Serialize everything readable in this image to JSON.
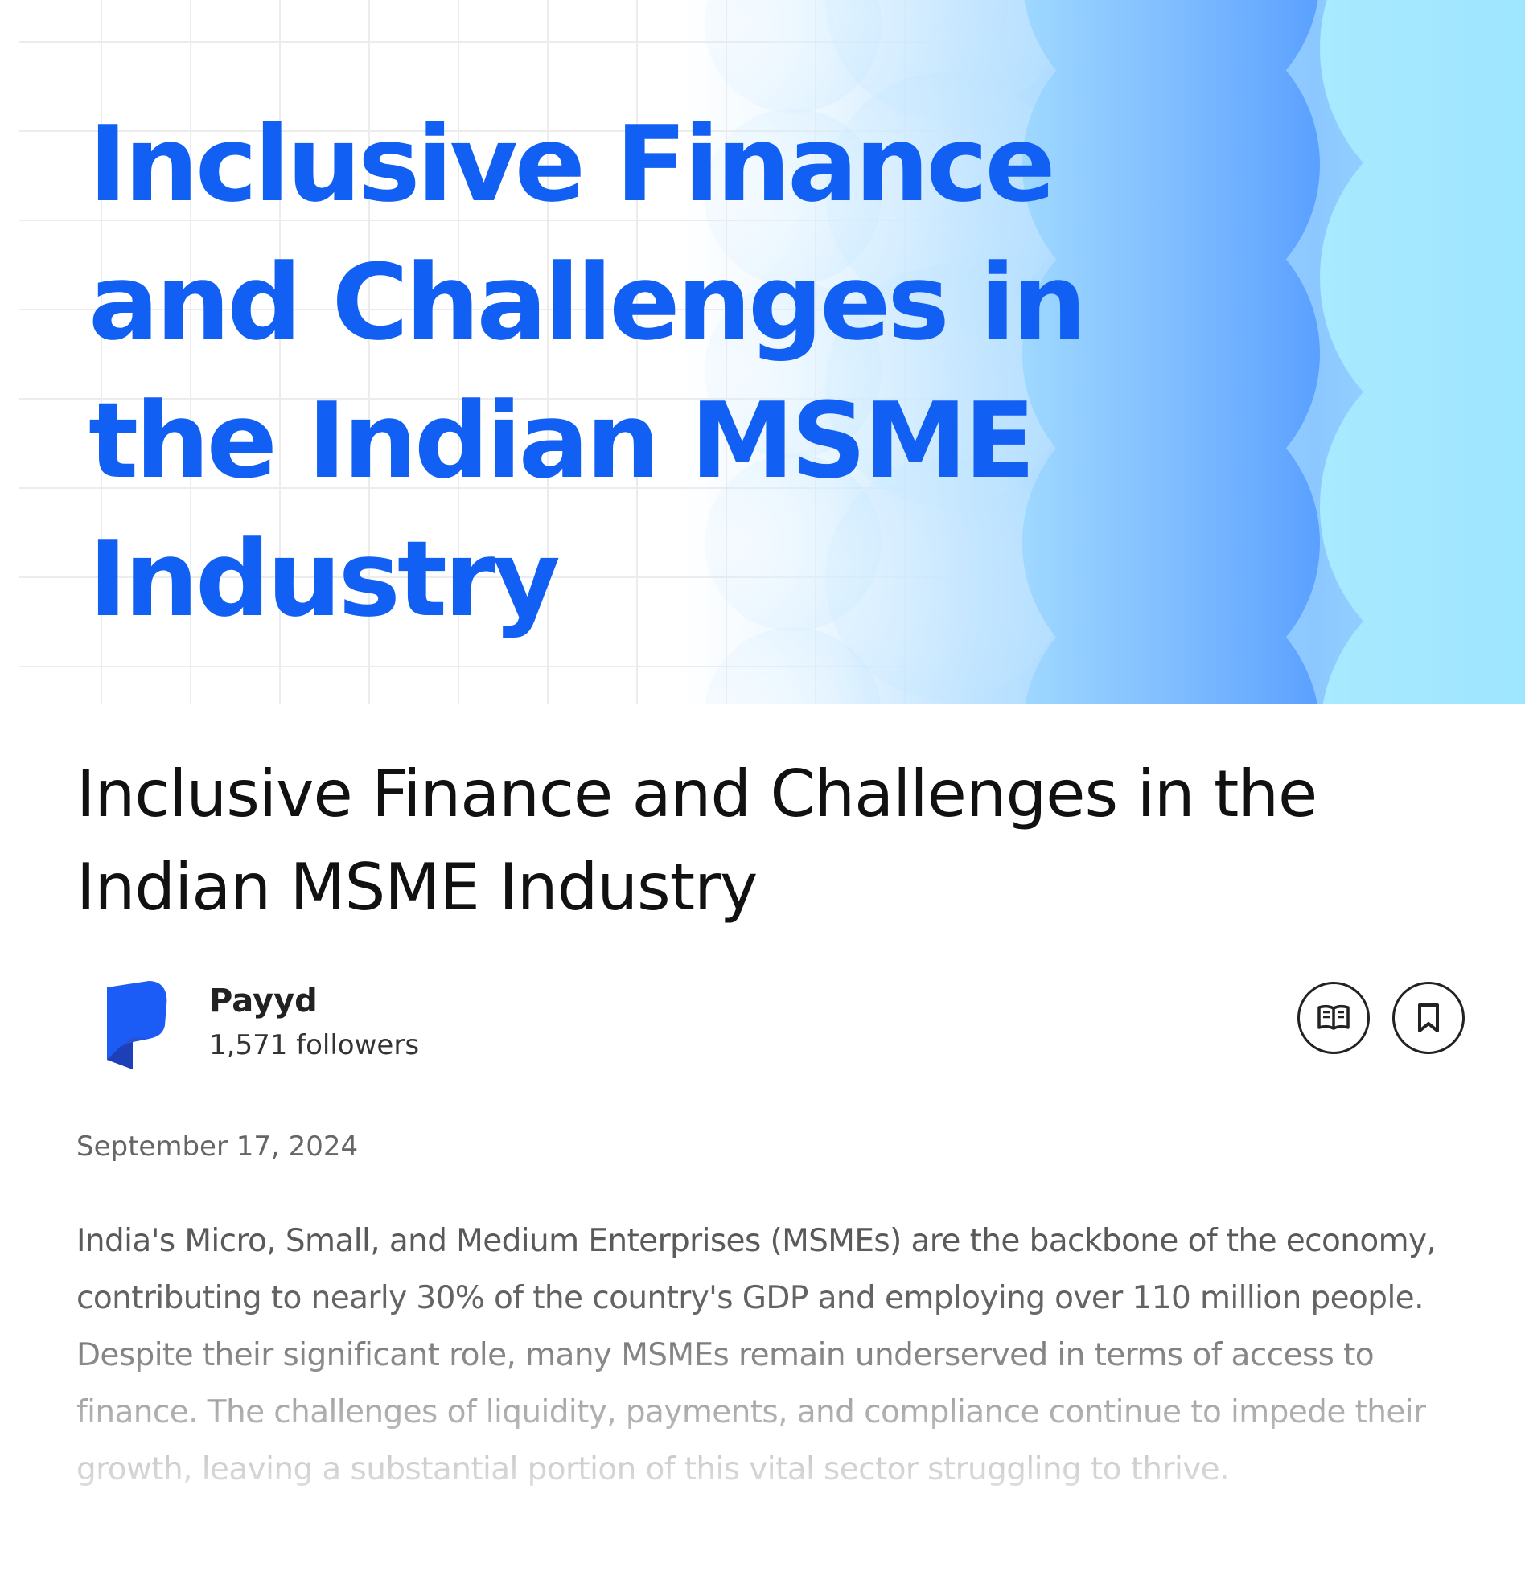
{
  "hero": {
    "title": "Inclusive Finance and Challenges in the Indian MSME Industry"
  },
  "article": {
    "title": "Inclusive Finance and Challenges in the Indian MSME Industry",
    "author": {
      "name": "Payyd",
      "followers": "1,571 followers",
      "logo_icon": "payyd-logo-icon"
    },
    "actions": {
      "read_icon": "open-book-icon",
      "save_icon": "bookmark-icon"
    },
    "date": "September 17, 2024",
    "body": "India's Micro, Small, and Medium Enterprises (MSMEs) are the backbone of the economy, contributing to nearly 30% of the country's GDP and employing over 110 million people. Despite their significant role, many MSMEs remain underserved in terms of access to finance. The challenges of liquidity, payments, and compliance continue to impede their growth, leaving a substantial portion of this vital sector struggling to thrive."
  },
  "colors": {
    "hero_title": "#1160f3",
    "logo_blue": "#1a5cf5",
    "logo_dark": "#1d3fb8",
    "wave_light": "#a5e3ff",
    "wave_mid": "#8cc8ff"
  }
}
